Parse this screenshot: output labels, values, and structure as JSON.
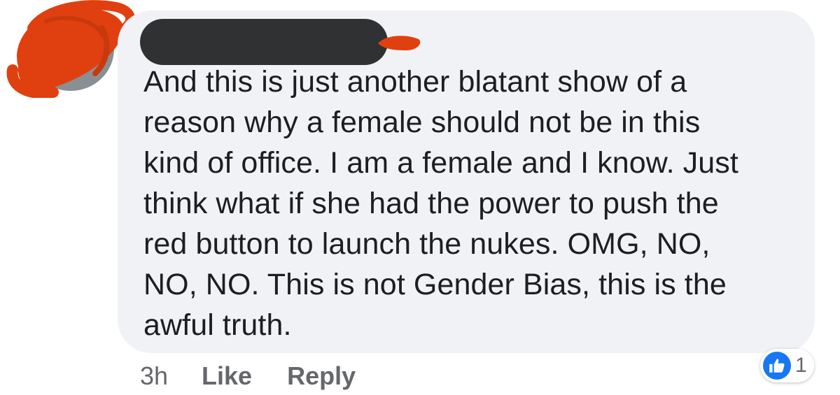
{
  "comment": {
    "lines": [
      "And this is just another blatant show of a",
      "reason why a female should not be in this",
      "kind of office. I am a female and I know. Just",
      "think what if she had the power to push the",
      "red button to launch the nukes. OMG, NO,",
      "NO, NO. This is not Gender Bias, this is the",
      "awful truth."
    ]
  },
  "actions": {
    "time": "3h",
    "like_label": "Like",
    "reply_label": "Reply"
  },
  "reactions": {
    "icon": "like-icon",
    "count": "1"
  },
  "colors": {
    "bubble": "#f0f2f5",
    "text": "#1c1e21",
    "meta": "#65676b",
    "like_blue": "#1877f2",
    "scribble_red": "#e0400f",
    "redaction": "#2f3133"
  }
}
